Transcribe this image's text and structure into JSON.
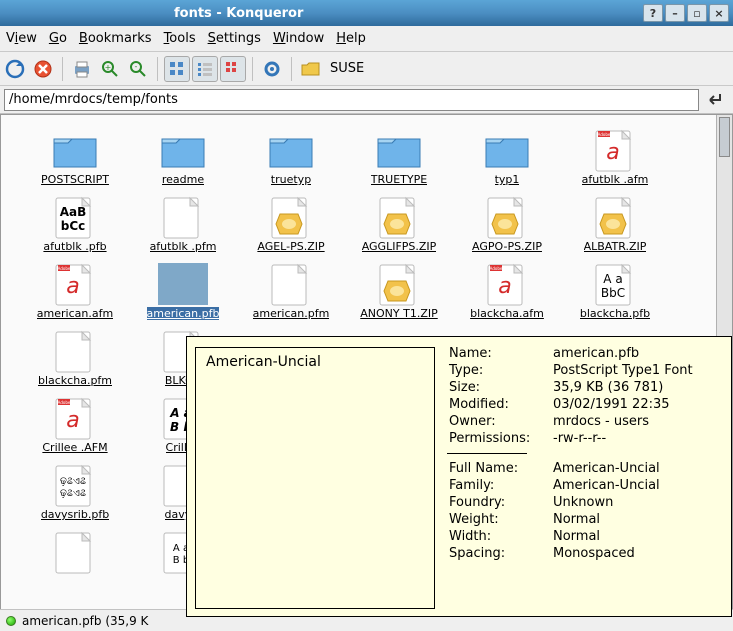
{
  "window": {
    "title": "fonts - Konqueror"
  },
  "menu": {
    "items": [
      "View",
      "Go",
      "Bookmarks",
      "Tools",
      "Settings",
      "Window",
      "Help"
    ]
  },
  "toolbar": {
    "suse_label": "SUSE"
  },
  "location": {
    "path": "/home/mrdocs/temp/fonts"
  },
  "grid": {
    "items": [
      {
        "label": "POSTSCRIPT",
        "type": "folder"
      },
      {
        "label": "readme",
        "type": "folder"
      },
      {
        "label": "truetyp",
        "type": "folder"
      },
      {
        "label": "TRUETYPE",
        "type": "folder"
      },
      {
        "label": "typ1",
        "type": "folder"
      },
      {
        "label": "afutblk .afm",
        "type": "afm"
      },
      {
        "label": "afutblk .pfb",
        "type": "pfb-aabb"
      },
      {
        "label": "afutblk .pfm",
        "type": "blank"
      },
      {
        "label": "AGEL-PS.ZIP",
        "type": "zip"
      },
      {
        "label": "AGGLIFPS.ZIP",
        "type": "zip"
      },
      {
        "label": "AGPO-PS.ZIP",
        "type": "zip"
      },
      {
        "label": "ALBATR.ZIP",
        "type": "zip"
      },
      {
        "label": "american.afm",
        "type": "afm"
      },
      {
        "label": "american.pfb",
        "type": "selected-blank"
      },
      {
        "label": "american.pfm",
        "type": "blank"
      },
      {
        "label": "ANONY T1.ZIP",
        "type": "zip"
      },
      {
        "label": "blackcha.afm",
        "type": "afm"
      },
      {
        "label": "blackcha.pfb",
        "type": "pfb-gothic"
      },
      {
        "label": "blackcha.pfm",
        "type": "blank"
      },
      {
        "label": "BLKCH",
        "type": "blank"
      },
      {
        "label": "",
        "type": "empty"
      },
      {
        "label": "",
        "type": "empty"
      },
      {
        "label": "",
        "type": "empty"
      },
      {
        "label": "",
        "type": "empty"
      },
      {
        "label": "Crillee .AFM",
        "type": "afm"
      },
      {
        "label": "Crillee",
        "type": "pfb-italic"
      },
      {
        "label": "",
        "type": "empty"
      },
      {
        "label": "",
        "type": "empty"
      },
      {
        "label": "",
        "type": "empty"
      },
      {
        "label": "",
        "type": "empty"
      },
      {
        "label": "davysrib.pfb",
        "type": "pfb-script"
      },
      {
        "label": "davysr",
        "type": "blank"
      },
      {
        "label": "",
        "type": "empty"
      },
      {
        "label": "",
        "type": "empty"
      },
      {
        "label": "",
        "type": "empty"
      },
      {
        "label": "",
        "type": "empty"
      },
      {
        "label": "",
        "type": "blank"
      },
      {
        "label": "",
        "type": "pfb-tiny"
      }
    ]
  },
  "status": {
    "text": "american.pfb (35,9 K"
  },
  "tooltip": {
    "preview_text": "American-Uncial",
    "rows1": [
      {
        "k": "Name:",
        "v": "american.pfb"
      },
      {
        "k": "Type:",
        "v": "PostScript Type1 Font"
      },
      {
        "k": "Size:",
        "v": "35,9 KB (36 781)"
      },
      {
        "k": "Modified:",
        "v": "03/02/1991 22:35"
      },
      {
        "k": "Owner:",
        "v": "mrdocs - users"
      },
      {
        "k": "Permissions:",
        "v": "-rw-r--r--"
      }
    ],
    "rows2": [
      {
        "k": "Full Name:",
        "v": "American-Uncial"
      },
      {
        "k": "Family:",
        "v": "American-Uncial"
      },
      {
        "k": "Foundry:",
        "v": "Unknown"
      },
      {
        "k": "Weight:",
        "v": "Normal"
      },
      {
        "k": "Width:",
        "v": "Normal"
      },
      {
        "k": "Spacing:",
        "v": "Monospaced"
      }
    ]
  }
}
